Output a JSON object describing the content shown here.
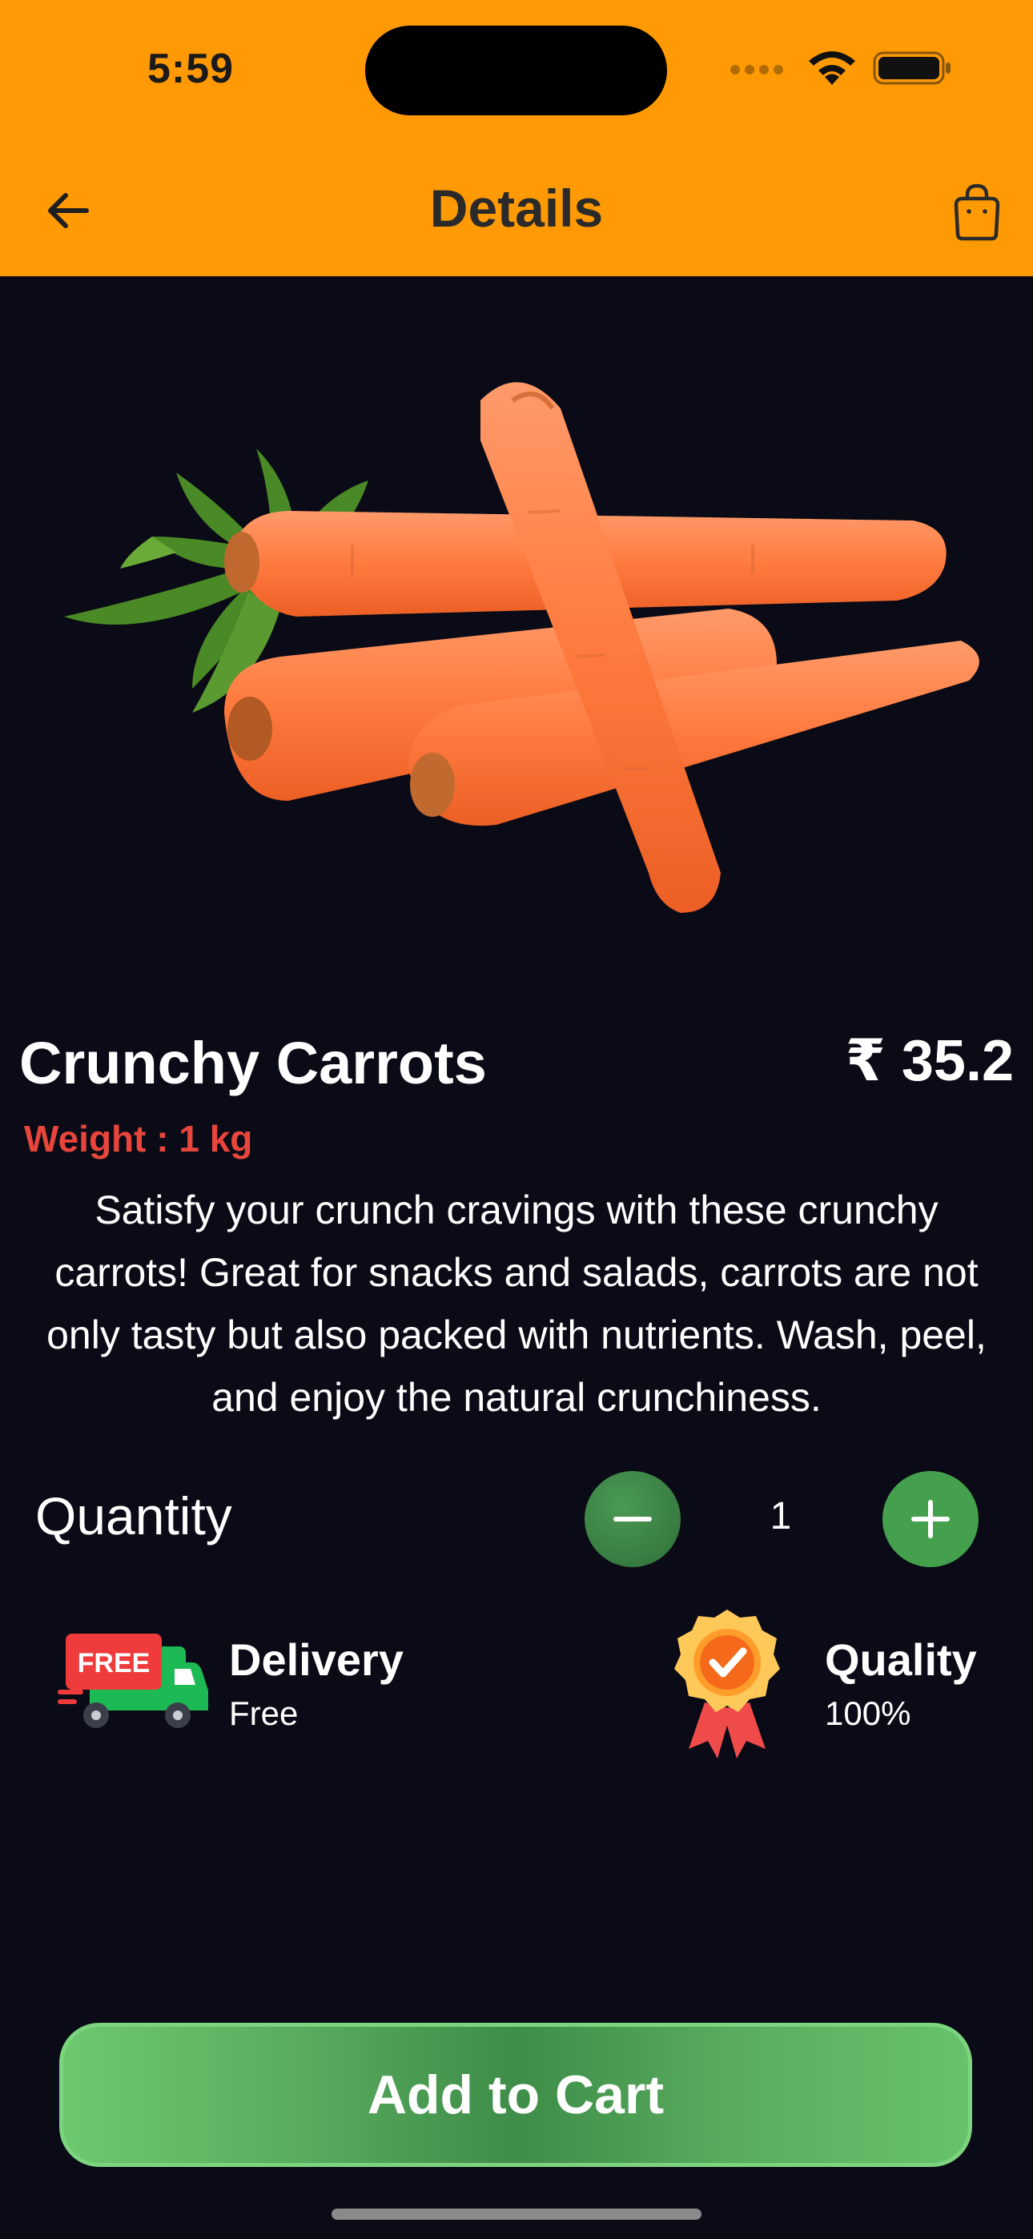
{
  "status_bar": {
    "time": "5:59"
  },
  "header": {
    "title": "Details"
  },
  "product": {
    "name": "Crunchy Carrots",
    "price": "₹ 35.2",
    "weight": "Weight : 1 kg",
    "description": "Satisfy your crunch cravings with these crunchy carrots! Great for snacks and salads, carrots are not only tasty but also packed with nutrients. Wash, peel, and enjoy the natural crunchiness."
  },
  "quantity": {
    "label": "Quantity",
    "value": "1"
  },
  "features": {
    "delivery": {
      "title": "Delivery",
      "subtitle": "Free",
      "badge": "FREE"
    },
    "quality": {
      "title": "Quality",
      "subtitle": "100%"
    }
  },
  "actions": {
    "add_to_cart": "Add to Cart"
  },
  "colors": {
    "header_bg": "#ff9a05",
    "page_bg": "#0a0b16",
    "accent_green": "#44a04d",
    "weight_red": "#e8453c"
  },
  "icons": [
    "back-arrow-icon",
    "shopping-bag-icon",
    "minus-icon",
    "plus-icon",
    "delivery-truck-icon",
    "quality-badge-icon",
    "wifi-icon",
    "battery-icon",
    "signal-icon"
  ]
}
